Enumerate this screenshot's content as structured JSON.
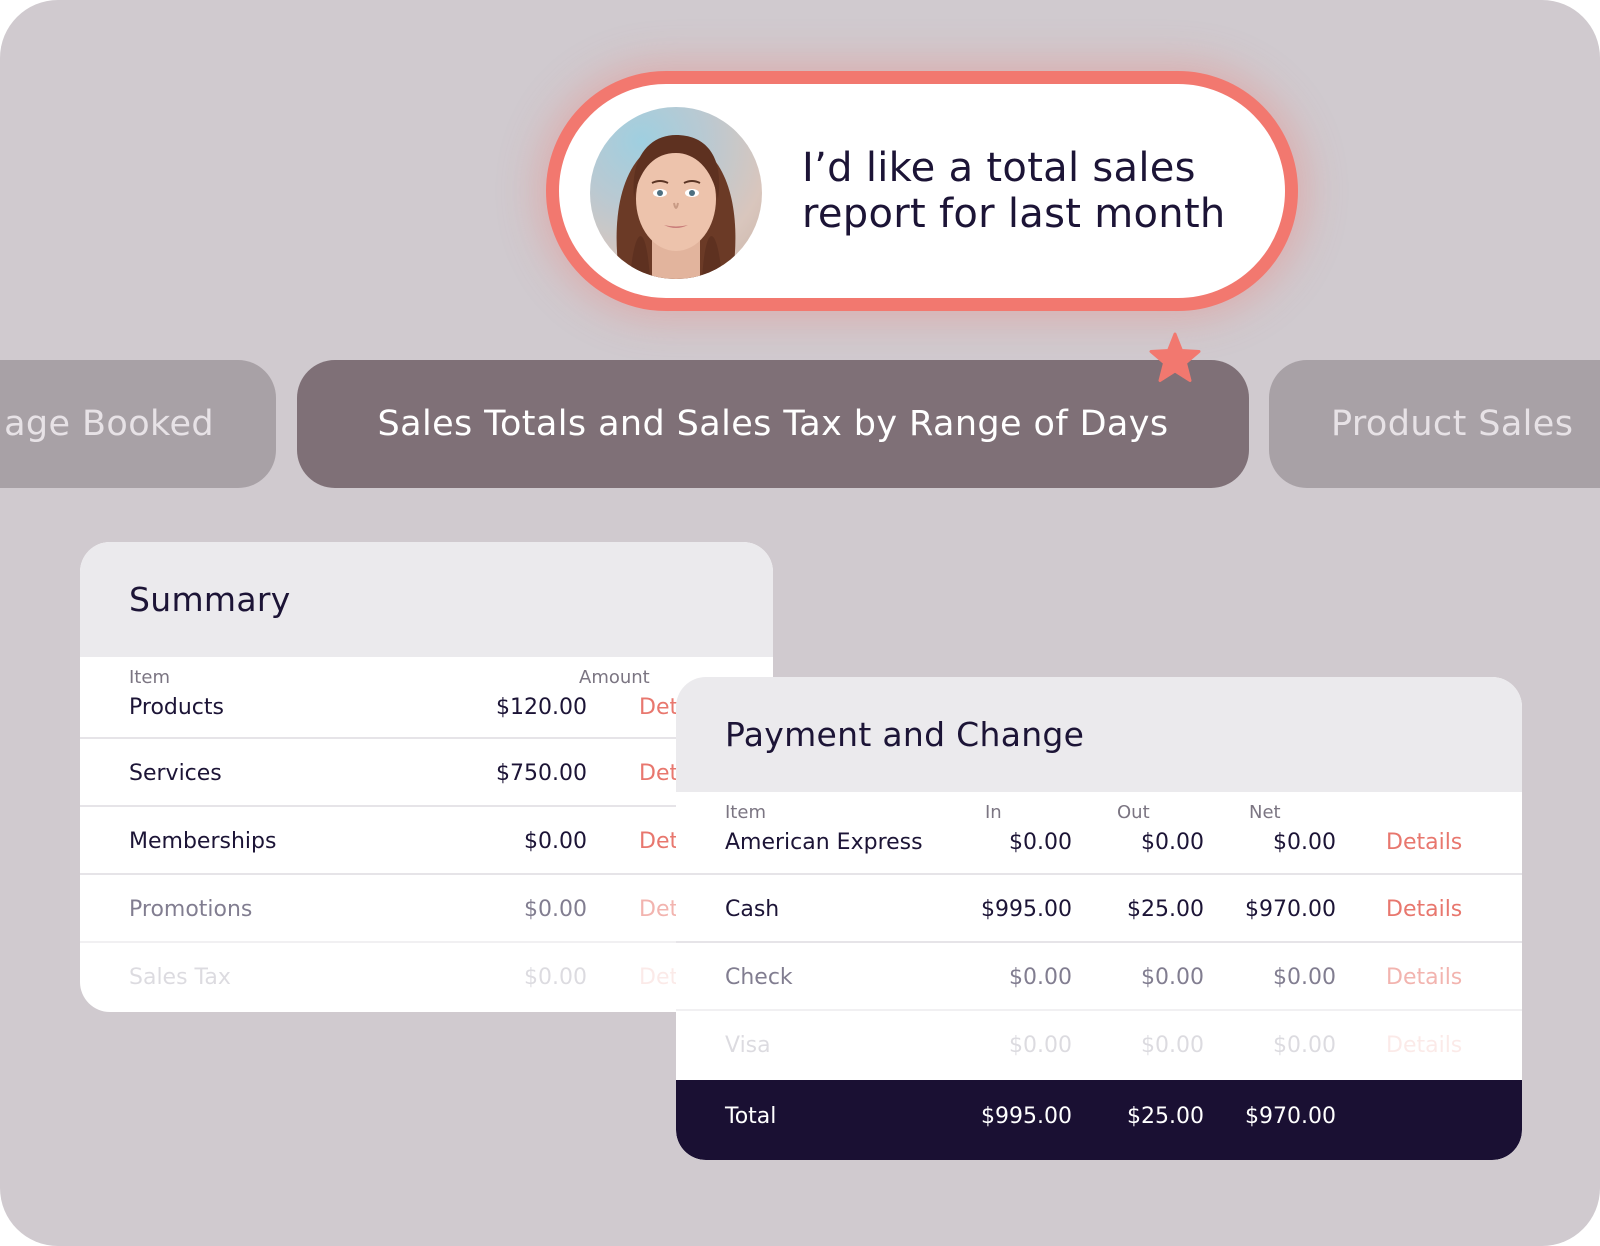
{
  "bubble": {
    "line1": "I’d like a total sales",
    "line2": "report for last month"
  },
  "chips": {
    "left": "age Booked",
    "active": "Sales Totals and Sales Tax by Range of Days",
    "right": "Product Sales"
  },
  "colors": {
    "accent": "#f2786f",
    "background": "#d0cacf",
    "chip_active": "#7f7077",
    "chip_inactive": "#a8a1a6",
    "navy": "#1a1033",
    "link": "#e8776e"
  },
  "summary": {
    "title": "Summary",
    "headers": {
      "item": "Item",
      "amount": "Amount"
    },
    "rows": [
      {
        "item": "Products",
        "amount": "$120.00",
        "link": "Det"
      },
      {
        "item": "Services",
        "amount": "$750.00",
        "link": "Det"
      },
      {
        "item": "Memberships",
        "amount": "$0.00",
        "link": "Det"
      },
      {
        "item": "Promotions",
        "amount": "$0.00",
        "link": "Det"
      },
      {
        "item": "Sales Tax",
        "amount": "$0.00",
        "link": "Det"
      }
    ]
  },
  "payment": {
    "title": "Payment and Change",
    "headers": {
      "item": "Item",
      "in": "In",
      "out": "Out",
      "net": "Net"
    },
    "rows": [
      {
        "item": "American Express",
        "in": "$0.00",
        "out": "$0.00",
        "net": "$0.00",
        "link": "Details"
      },
      {
        "item": "Cash",
        "in": "$995.00",
        "out": "$25.00",
        "net": "$970.00",
        "link": "Details"
      },
      {
        "item": "Check",
        "in": "$0.00",
        "out": "$0.00",
        "net": "$0.00",
        "link": "Details"
      },
      {
        "item": "Visa",
        "in": "$0.00",
        "out": "$0.00",
        "net": "$0.00",
        "link": "Details"
      }
    ],
    "total": {
      "label": "Total",
      "in": "$995.00",
      "out": "$25.00",
      "net": "$970.00"
    }
  }
}
